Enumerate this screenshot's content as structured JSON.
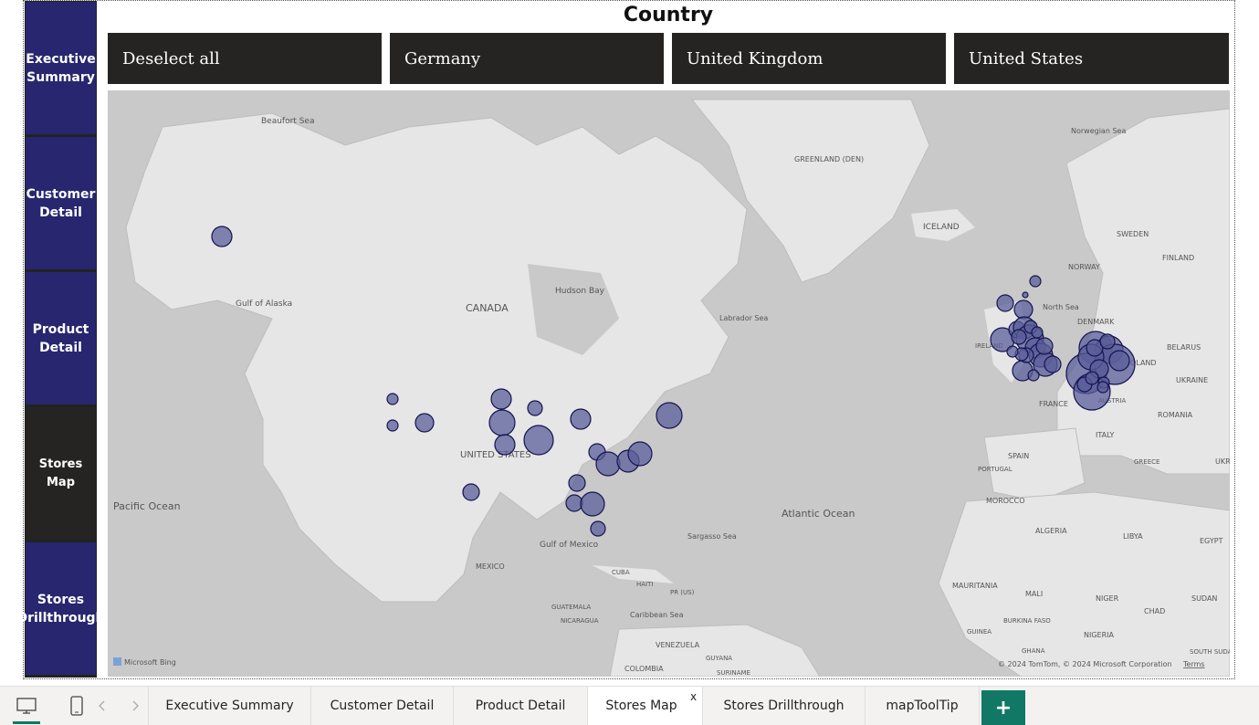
{
  "nav": {
    "items": [
      "Executive Summary",
      "Customer Detail",
      "Product Detail",
      "Stores Map",
      "Stores Drillthrough"
    ]
  },
  "slicer": {
    "title": "Country",
    "options": [
      "Deselect all",
      "Germany",
      "United Kingdom",
      "United States"
    ]
  },
  "map": {
    "labels": {
      "beaufort": "Beaufort Sea",
      "gulf_alaska": "Gulf of Alaska",
      "canada": "CANADA",
      "hudson": "Hudson Bay",
      "labrador": "Labrador Sea",
      "greenland": "GREENLAND (DEN)",
      "iceland": "ICELAND",
      "norwegian": "Norwegian Sea",
      "sweden": "SWEDEN",
      "norway": "NORWAY",
      "finland": "FINLAND",
      "north_sea": "North Sea",
      "ireland": "IRELAND",
      "denmark": "DENMARK",
      "belarus": "BELARUS",
      "poland": "OLAND",
      "ukraine": "UKRAINE",
      "france": "FRANCE",
      "austria": "AUSTRIA",
      "romania": "ROMANIA",
      "italy": "ITALY",
      "spain": "SPAIN",
      "portugal": "PORTUGAL",
      "greece": "GREECE",
      "morocco": "MOROCCO",
      "algeria": "ALGERIA",
      "libya": "LIBYA",
      "egypt": "EGYPT",
      "us": "UNITED STATES",
      "pacific": "Pacific Ocean",
      "atlantic": "Atlantic Ocean",
      "sargasso": "Sargasso Sea",
      "gulf_mexico": "Gulf of Mexico",
      "mexico": "MEXICO",
      "cuba": "CUBA",
      "haiti": "HAITI",
      "pr": "PR (US)",
      "guatemala": "GUATEMALA",
      "nicaragua": "NICARAGUA",
      "caribbean": "Caribbean Sea",
      "venezuela": "VENEZUELA",
      "colombia": "COLOMBIA",
      "guyana": "GUYANA",
      "suriname": "SURINAME",
      "mauritania": "MAURITANIA",
      "mali": "MALI",
      "niger": "NIGER",
      "chad": "CHAD",
      "sudan": "SUDAN",
      "burkina": "BURKINA FASO",
      "guinea": "GUINEA",
      "ghana": "GHANA",
      "nigeria": "NIGERIA",
      "south_sudan": "SOUTH SUDAN",
      "ukr": "UKR"
    },
    "logo": "Microsoft Bing",
    "attribution": "© 2024 TomTom, © 2024 Microsoft Corporation",
    "terms": "Terms",
    "bubble_color": "#5b5d99"
  },
  "tabs": {
    "items": [
      "Executive Summary",
      "Customer Detail",
      "Product Detail",
      "Stores Map",
      "Stores Drillthrough",
      "mapToolTip"
    ],
    "active": "Stores Map",
    "close_glyph": "x",
    "add_glyph": "+"
  },
  "colors": {
    "nav_blue": "#27266f",
    "dark": "#252423",
    "add_green": "#117865"
  }
}
